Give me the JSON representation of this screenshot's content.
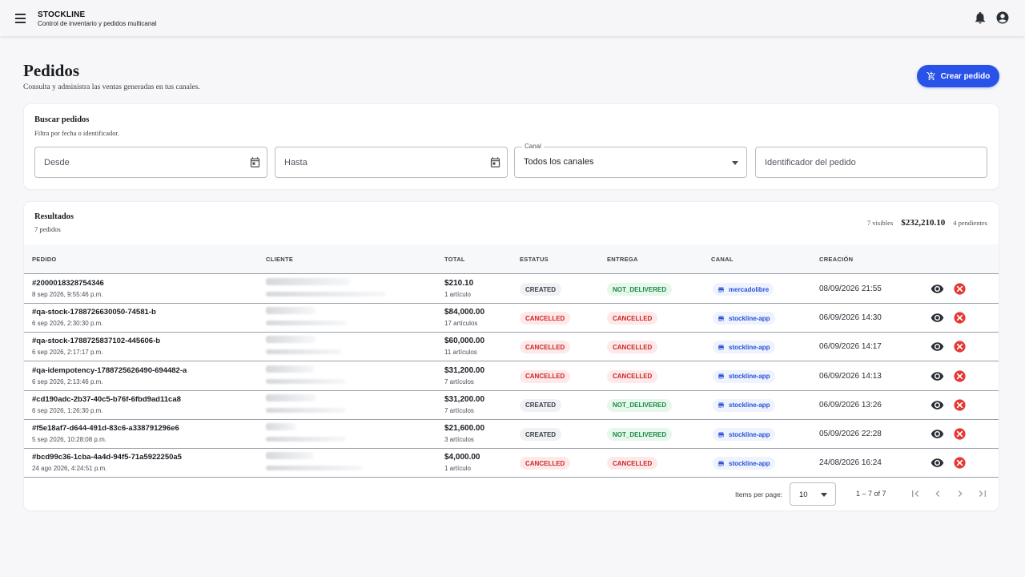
{
  "app": {
    "name": "STOCKLINE",
    "subtitle": "Control de inventario y pedidos multicanal"
  },
  "header": {
    "title": "Pedidos",
    "subtitle": "Consulta y administra las ventas generadas en tus canales.",
    "create_button": "Crear pedido"
  },
  "search": {
    "title": "Buscar pedidos",
    "subtitle": "Filtra por fecha o identificador.",
    "from_placeholder": "Desde",
    "to_placeholder": "Hasta",
    "channel_label": "Canal",
    "channel_value": "Todos los canales",
    "id_placeholder": "Identificador del pedido"
  },
  "results": {
    "title": "Resultados",
    "count_label": "7 pedidos",
    "visible_label": "7 visibles",
    "total_amount": "$232,210.10",
    "pending_label": "4 pendientes"
  },
  "table": {
    "columns": [
      "PEDIDO",
      "CLIENTE",
      "TOTAL",
      "ESTATUS",
      "ENTREGA",
      "CANAL",
      "CREACIÓN"
    ],
    "rows": [
      {
        "id": "#2000018328754346",
        "date": "8 sep 2026, 9:55:46 p.m.",
        "total": "$210.10",
        "items": "1 artículo",
        "status": "CREATED",
        "delivery": "NOT_DELIVERED",
        "channel": "mercadolibre",
        "created": "08/09/2026 21:55"
      },
      {
        "id": "#qa-stock-1788726630050-74581-b",
        "date": "6 sep 2026, 2:30:30 p.m.",
        "total": "$84,000.00",
        "items": "17 artículos",
        "status": "CANCELLED",
        "delivery": "CANCELLED",
        "channel": "stockline-app",
        "created": "06/09/2026 14:30"
      },
      {
        "id": "#qa-stock-1788725837102-445606-b",
        "date": "6 sep 2026, 2:17:17 p.m.",
        "total": "$60,000.00",
        "items": "11 artículos",
        "status": "CANCELLED",
        "delivery": "CANCELLED",
        "channel": "stockline-app",
        "created": "06/09/2026 14:17"
      },
      {
        "id": "#qa-idempotency-1788725626490-694482-a",
        "date": "6 sep 2026, 2:13:46 p.m.",
        "total": "$31,200.00",
        "items": "7 artículos",
        "status": "CANCELLED",
        "delivery": "CANCELLED",
        "channel": "stockline-app",
        "created": "06/09/2026 14:13"
      },
      {
        "id": "#cd190adc-2b37-40c5-b76f-6fbd9ad11ca8",
        "date": "6 sep 2026, 1:26:30 p.m.",
        "total": "$31,200.00",
        "items": "7 artículos",
        "status": "CREATED",
        "delivery": "NOT_DELIVERED",
        "channel": "stockline-app",
        "created": "06/09/2026 13:26"
      },
      {
        "id": "#f5e18af7-d644-491d-83c6-a338791296e6",
        "date": "5 sep 2026, 10:28:08 p.m.",
        "total": "$21,600.00",
        "items": "3 artículos",
        "status": "CREATED",
        "delivery": "NOT_DELIVERED",
        "channel": "stockline-app",
        "created": "05/09/2026 22:28"
      },
      {
        "id": "#bcd99c36-1cba-4a4d-94f5-71a5922250a5",
        "date": "24 ago 2026, 4:24:51 p.m.",
        "total": "$4,000.00",
        "items": "1 artículo",
        "status": "CANCELLED",
        "delivery": "CANCELLED",
        "channel": "stockline-app",
        "created": "24/08/2026 16:24"
      }
    ]
  },
  "paginator": {
    "items_per_page_label": "Items per page:",
    "page_size": "10",
    "range_label": "1 – 7 of 7"
  },
  "colors": {
    "primary": "#2952e8",
    "success": "#1c8a44",
    "danger": "#d02424",
    "channel": "#2851d6"
  },
  "icons": [
    "menu-icon",
    "bell-icon",
    "account-icon",
    "cart-add-icon",
    "calendar-icon",
    "store-icon",
    "eye-icon",
    "cancel-circle-icon",
    "first-page-icon",
    "prev-page-icon",
    "next-page-icon",
    "last-page-icon"
  ]
}
